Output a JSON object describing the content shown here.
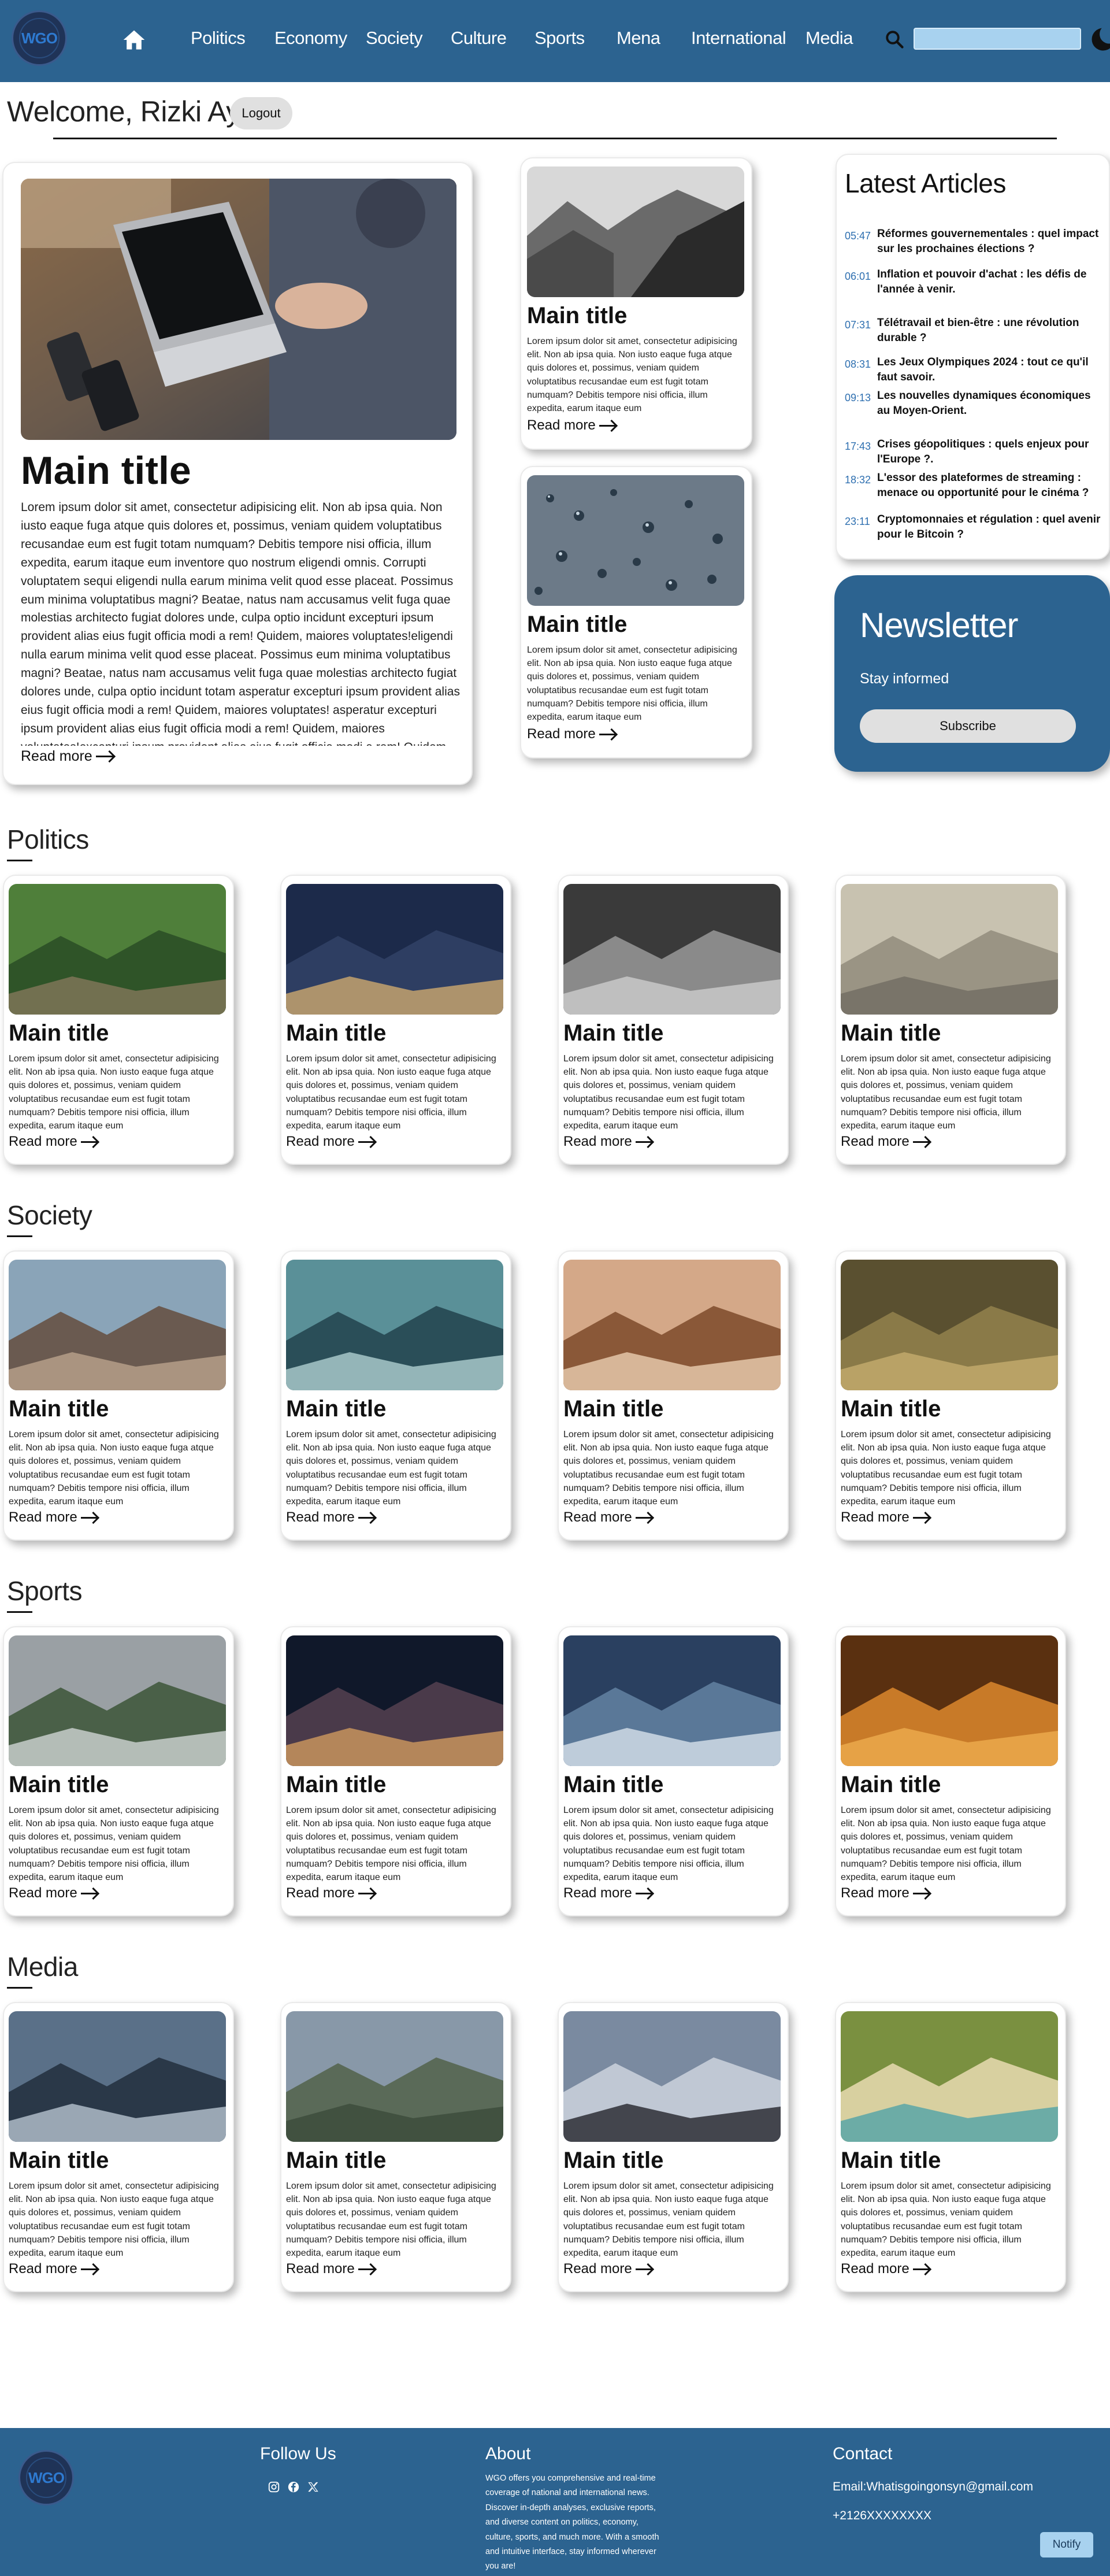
{
  "nav": {
    "logo": "WGO",
    "links": [
      "Politics",
      "Economy",
      "Society",
      "Culture",
      "Sports",
      "Mena",
      "International",
      "Media"
    ],
    "search_placeholder": ""
  },
  "welcome": {
    "text": "Welcome, Rizki Ayoub",
    "logout_label": "Logout"
  },
  "card_common": {
    "title": "Main title",
    "short_body": "Lorem ipsum dolor sit amet, consectetur adipisicing elit. Non ab ipsa quia. Non iusto eaque fuga atque quis dolores et, possimus, veniam quidem voluptatibus recusandae eum est fugit totam numquam? Debitis tempore nisi officia, illum expedita, earum itaque eum",
    "long_body": "Lorem ipsum dolor sit amet, consectetur adipisicing elit. Non ab ipsa quia. Non iusto eaque fuga atque quis dolores et, possimus, veniam quidem voluptatibus recusandae eum est fugit totam numquam? Debitis tempore nisi officia, illum expedita, earum itaque eum inventore quo nostrum eligendi omnis. Corrupti voluptatem sequi eligendi nulla earum minima velit quod esse placeat. Possimus eum minima voluptatibus magni? Beatae, natus nam accusamus velit fuga quae molestias architecto fugiat dolores unde, culpa optio incidunt excepturi ipsum provident alias eius fugit officia modi a rem! Quidem, maiores voluptates!eligendi nulla earum minima velit quod esse placeat. Possimus eum minima voluptatibus magni? Beatae, natus nam accusamus velit fuga quae molestias architecto fugiat dolores unde, culpa optio incidunt totam asperatur excepturi ipsum provident alias eius fugit officia modi a rem! Quidem, maiores voluptates! asperatur excepturi ipsum provident alias eius fugit officia modi a rem! Quidem, maiores voluptates!excepturi ipsum provident alias eius fugit officia modi a rem! Quidem",
    "read_more": "Read more"
  },
  "latest": {
    "heading": "Latest Articles",
    "items": [
      {
        "time": "05:47",
        "text": "Réformes gouvernementales : quel impact sur les prochaines élections ?"
      },
      {
        "time": "06:01",
        "text": "Inflation et pouvoir d'achat : les défis de l'année à venir."
      },
      {
        "time": "07:31",
        "text": "Télétravail et bien-être : une révolution durable ?"
      },
      {
        "time": "08:31",
        "text": "Les Jeux Olympiques 2024 : tout ce qu'il faut savoir."
      },
      {
        "time": "09:13",
        "text": "Les nouvelles dynamiques économiques au Moyen-Orient."
      },
      {
        "time": "17:43",
        "text": "Crises géopolitiques : quels enjeux pour l'Europe ?."
      },
      {
        "time": "18:32",
        "text": "L'essor des plateformes de streaming : menace ou opportunité pour le cinéma ?"
      },
      {
        "time": "23:11",
        "text": "Cryptomonnaies et régulation : quel avenir pour le Bitcoin ?"
      }
    ]
  },
  "newsletter": {
    "title": "Newsletter",
    "subtitle": "Stay informed",
    "button": "Subscribe"
  },
  "sections": [
    {
      "title": "Politics",
      "images": [
        "forest-stream",
        "bridge-night",
        "bicycle-bw",
        "beach-crowd"
      ]
    },
    {
      "title": "Society",
      "images": [
        "skatepark-palms",
        "cable-car",
        "cathedral-arches",
        "waterfall-cliff"
      ]
    },
    {
      "title": "Sports",
      "images": [
        "misty-mountain",
        "night-sky-gradient",
        "sky-clouds",
        "golden-grass"
      ]
    },
    {
      "title": "Media",
      "images": [
        "tower-sky",
        "mountain-ridge",
        "person-lake",
        "coastal-valley"
      ]
    }
  ],
  "footer": {
    "follow": "Follow Us",
    "about_title": "About",
    "about_text": "WGO offers you comprehensive and real-time coverage of national and international news. Discover in-depth analyses, exclusive reports, and diverse content on politics, economy, culture, sports, and much more. With a smooth and intuitive interface, stay informed wherever you are!",
    "contact_title": "Contact",
    "email": "Email:Whatisgoingonsyn@gmail.com",
    "phone": "+2126XXXXXXXX",
    "notify": "Notify"
  },
  "colors": {
    "primary": "#2c6390",
    "accent": "#a8d2ef",
    "time": "#2e6fb0"
  }
}
